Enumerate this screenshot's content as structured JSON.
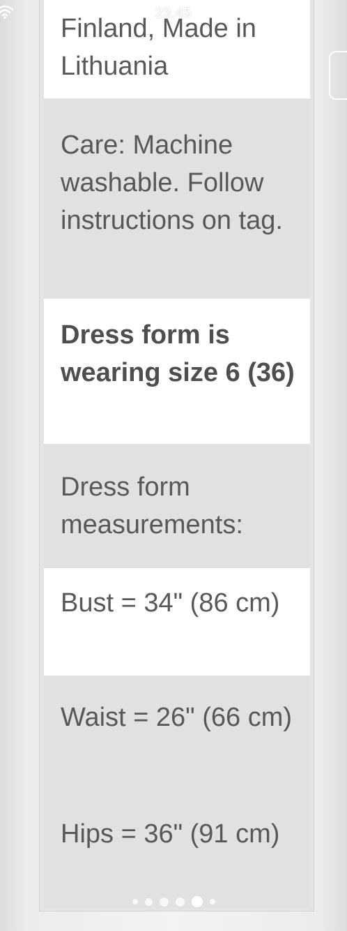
{
  "status_bar": {
    "time": "23.45"
  },
  "icons": {
    "wifi": "wifi-icon"
  },
  "specs": [
    {
      "text": "Finland, Made in Lithuania",
      "style": "light"
    },
    {
      "text": "Care: Machine washable. Follow instructions on tag.",
      "style": "dark"
    },
    {
      "text": "Dress form is wearing size 6 (36)",
      "style": "light",
      "bold": true
    },
    {
      "text": "Dress form measurements:",
      "style": "dark"
    },
    {
      "text": "Bust = 34\" (86 cm)",
      "style": "light"
    },
    {
      "text": "Waist = 26\" (66 cm)",
      "style": "dark"
    },
    {
      "text": "Hips = 36\" (91 cm)",
      "style": "dark"
    }
  ],
  "pager": {
    "dots": 6,
    "active_index": 4
  },
  "colors": {
    "row_light": "#ffffff",
    "row_dark": "#e1e1e1",
    "text": "#585858"
  }
}
